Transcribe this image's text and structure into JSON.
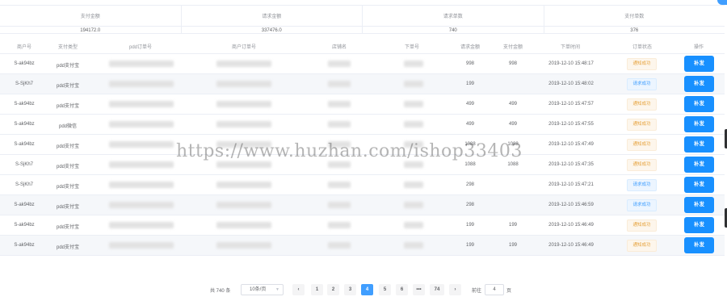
{
  "summary": [
    {
      "label": "支付金额",
      "value": "194172.0"
    },
    {
      "label": "请求金额",
      "value": "337476.0"
    },
    {
      "label": "请求单数",
      "value": "740"
    },
    {
      "label": "支付单数",
      "value": "376"
    }
  ],
  "table": {
    "headers": [
      "商户号",
      "支付类型",
      "pdd订单号",
      "商户订单号",
      "店铺名",
      "下单号",
      "请求金额",
      "支付金额",
      "下单时间",
      "订单状态",
      "操作"
    ],
    "rows": [
      {
        "merchant": "S-ak94bz",
        "pay_type": "pdd支付宝",
        "request_amount": "998",
        "pay_amount": "998",
        "time": "2019-12-10 15:48:17",
        "status": "通知成功",
        "status_kind": "warn",
        "action": "补发"
      },
      {
        "merchant": "S-SjKh7",
        "pay_type": "pdd支付宝",
        "request_amount": "199",
        "pay_amount": "",
        "time": "2019-12-10 15:48:02",
        "status": "请求成功",
        "status_kind": "info",
        "action": "补发"
      },
      {
        "merchant": "S-ak94bz",
        "pay_type": "pdd支付宝",
        "request_amount": "499",
        "pay_amount": "499",
        "time": "2019-12-10 15:47:57",
        "status": "通知成功",
        "status_kind": "warn",
        "action": "补发"
      },
      {
        "merchant": "S-ak94bz",
        "pay_type": "pdd微信",
        "request_amount": "499",
        "pay_amount": "499",
        "time": "2019-12-10 15:47:55",
        "status": "通知成功",
        "status_kind": "warn",
        "action": "补发"
      },
      {
        "merchant": "S-ak94bz",
        "pay_type": "pdd支付宝",
        "request_amount": "1088",
        "pay_amount": "1088",
        "time": "2019-12-10 15:47:49",
        "status": "通知成功",
        "status_kind": "warn",
        "action": "补发"
      },
      {
        "merchant": "S-SjKh7",
        "pay_type": "pdd支付宝",
        "request_amount": "1088",
        "pay_amount": "1088",
        "time": "2019-12-10 15:47:35",
        "status": "通知成功",
        "status_kind": "warn",
        "action": "补发"
      },
      {
        "merchant": "S-SjKh7",
        "pay_type": "pdd支付宝",
        "request_amount": "298",
        "pay_amount": "",
        "time": "2019-12-10 15:47:21",
        "status": "请求成功",
        "status_kind": "info",
        "action": "补发"
      },
      {
        "merchant": "S-ak94bz",
        "pay_type": "pdd支付宝",
        "request_amount": "298",
        "pay_amount": "",
        "time": "2019-12-10 15:46:59",
        "status": "请求成功",
        "status_kind": "info",
        "action": "补发"
      },
      {
        "merchant": "S-ak94bz",
        "pay_type": "pdd支付宝",
        "request_amount": "199",
        "pay_amount": "199",
        "time": "2019-12-10 15:46:49",
        "status": "通知成功",
        "status_kind": "warn",
        "action": "补发"
      },
      {
        "merchant": "S-ak94bz",
        "pay_type": "pdd支付宝",
        "request_amount": "199",
        "pay_amount": "199",
        "time": "2019-12-10 15:46:49",
        "status": "通知成功",
        "status_kind": "warn",
        "action": "补发"
      }
    ]
  },
  "pagination": {
    "total_text": "共 740 条",
    "page_size": "10条/页",
    "prev": "‹",
    "next": "›",
    "pages": [
      "1",
      "2",
      "3",
      "4",
      "5",
      "6",
      "•••",
      "74"
    ],
    "current": "4",
    "goto_label": "前往",
    "goto_value": "4",
    "goto_suffix": "页"
  },
  "watermark": "https://www.huzhan.com/ishop33403",
  "colors": {
    "primary": "#1890ff",
    "warning": "#e6a23c",
    "info": "#409eff"
  }
}
